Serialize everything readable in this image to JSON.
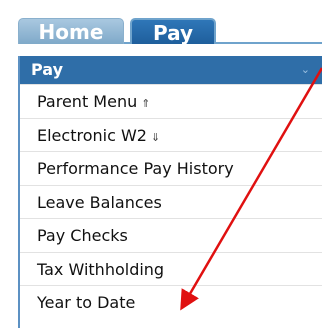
{
  "tabs": [
    {
      "label": "Home",
      "active": false
    },
    {
      "label": "Pay",
      "active": true
    }
  ],
  "menu": {
    "header": "Pay",
    "header_icon": "chevron-down-icon",
    "items": [
      {
        "label": "Parent Menu",
        "icon": "up-arrow-icon",
        "glyph": "⇑"
      },
      {
        "label": "Electronic W2",
        "icon": "down-arrow-icon",
        "glyph": "⇓"
      },
      {
        "label": "Performance Pay History"
      },
      {
        "label": "Leave Balances"
      },
      {
        "label": "Pay Checks"
      },
      {
        "label": "Tax Withholding"
      },
      {
        "label": "Year to Date"
      }
    ]
  },
  "colors": {
    "header": "#2f6ea8",
    "tab_active": "#2f77b8",
    "tab_inactive": "#a9c8e0",
    "annotation_arrow": "#e01010"
  }
}
